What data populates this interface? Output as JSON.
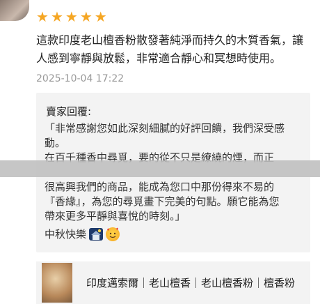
{
  "review": {
    "rating": 5,
    "text": "這款印度老山檀香粉散發著純淨而持久的木質香氣，讓人感到寧靜與放鬆，非常適合靜心和冥想時使用。",
    "timestamp": "2025-10-04 17:22"
  },
  "reply": {
    "title": "賣家回覆:",
    "lines": [
      "「非常感謝您如此深刻細膩的好評回饋，我們深受感",
      "動。",
      "在百千種香中尋覓，要的從不只是繚繞的煙，而正",
      "",
      "很高興我們的商品，能成為您口中那份得來不易的",
      "『香緣』，為您的尋覓畫下完美的句點。願它能為您",
      "帶來更多平靜與喜悅的時刻。」"
    ],
    "sign": "中秋快樂",
    "sign_icons": [
      "moon-house-emoji-icon",
      "smiling-face-hearts-emoji-icon"
    ]
  },
  "product": {
    "title": "印度邁索爾｜老山檀香｜老山檀香粉｜檀香粉",
    "thumb_icon": "product-thumbnail"
  },
  "colors": {
    "star": "#f5a623",
    "reply_bg": "#f3f3f3",
    "timestamp": "#999999"
  }
}
